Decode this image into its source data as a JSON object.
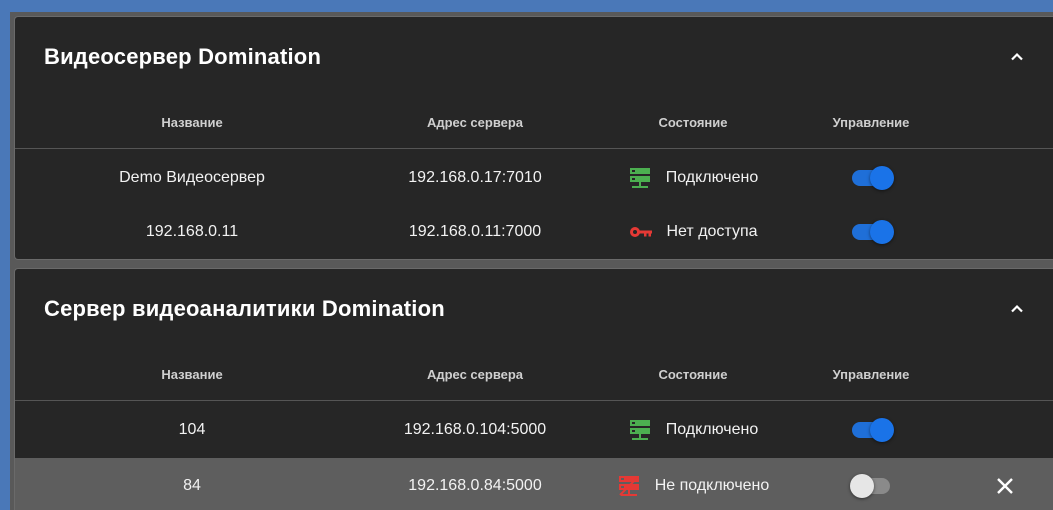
{
  "colors": {
    "connected": "#4caf50",
    "no_access": "#e53935",
    "disconnected": "#e53935",
    "toggle_on": "#1a73e8",
    "panel_bg": "#262626"
  },
  "panels": [
    {
      "title": "Видеосервер Domination",
      "collapse_icon": "chevron-up-icon",
      "headers": {
        "name": "Название",
        "address": "Адрес сервера",
        "state": "Состояние",
        "control": "Управление"
      },
      "rows": [
        {
          "name": "Demo Видеосервер",
          "address": "192.168.0.17:7010",
          "state": "Подключено",
          "state_icon": "server-connected-icon",
          "enabled": true
        },
        {
          "name": "192.168.0.11",
          "address": "192.168.0.11:7000",
          "state": "Нет доступа",
          "state_icon": "key-icon",
          "enabled": true
        }
      ]
    },
    {
      "title": "Сервер видеоаналитики Domination",
      "collapse_icon": "chevron-up-icon",
      "headers": {
        "name": "Название",
        "address": "Адрес сервера",
        "state": "Состояние",
        "control": "Управление"
      },
      "rows": [
        {
          "name": "104",
          "address": "192.168.0.104:5000",
          "state": "Подключено",
          "state_icon": "server-connected-icon",
          "enabled": true
        },
        {
          "name": "84",
          "address": "192.168.0.84:5000",
          "state": "Не подключено",
          "state_icon": "server-disconnected-icon",
          "enabled": false,
          "delete_icon": "close-icon"
        }
      ]
    }
  ]
}
